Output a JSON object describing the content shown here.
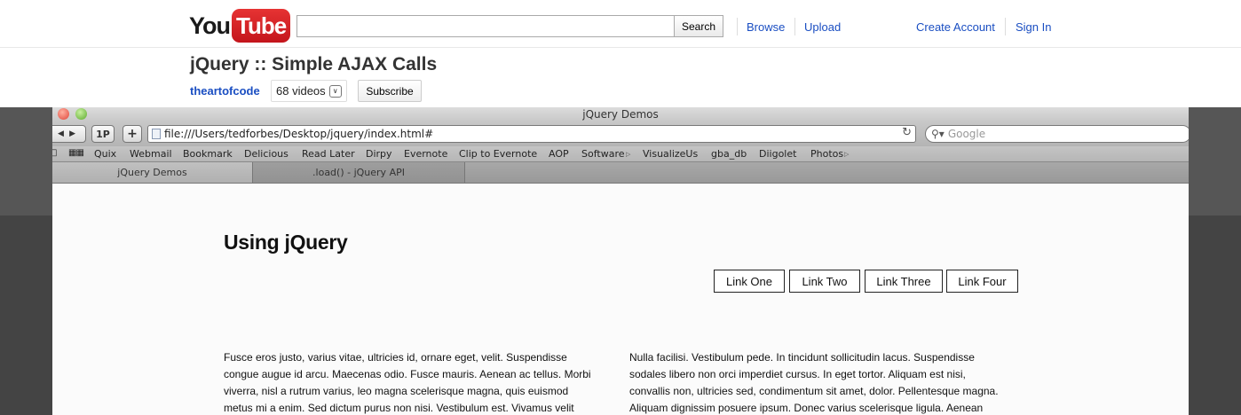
{
  "youtube": {
    "logo_you": "You",
    "logo_tube": "Tube",
    "search_value": "",
    "search_button": "Search",
    "nav": {
      "browse": "Browse",
      "upload": "Upload",
      "create_account": "Create Account",
      "sign_in": "Sign In"
    },
    "video_title": "jQuery :: Simple AJAX Calls",
    "channel": "theartofcode",
    "video_count": "68 videos",
    "subscribe": "Subscribe"
  },
  "browser": {
    "window_title": "jQuery Demos",
    "toolbar": {
      "onepassword": "1P",
      "add_tab": "+",
      "url": "file:///Users/tedforbes/Desktop/jquery/index.html#",
      "search_placeholder": "Google"
    },
    "bookmarks": [
      "Quix",
      "Webmail",
      "Bookmark",
      "Delicious",
      "Read Later",
      "Dirpy",
      "Evernote",
      "Clip to Evernote",
      "AOP",
      "Software",
      "VisualizeUs",
      "gba_db",
      "Diigolet",
      "Photos"
    ],
    "tabs": [
      {
        "label": "jQuery Demos",
        "active": true
      },
      {
        "label": ".load() - jQuery API",
        "active": false
      }
    ]
  },
  "page": {
    "heading": "Using jQuery",
    "links": [
      "Link One",
      "Link Two",
      "Link Three",
      "Link Four"
    ],
    "paragraphs": [
      [
        "Fusce eros justo, varius vitae, ultricies id, ornare eget, velit. Suspendisse",
        "congue augue id arcu. Maecenas odio. Fusce mauris. Aenean ac tellus. Morbi",
        "viverra, nisl a rutrum varius, leo magna scelerisque magna, quis euismod",
        "metus mi a enim. Sed dictum purus non nisi. Vestibulum est. Vivamus velit"
      ],
      [
        "Nulla facilisi. Vestibulum pede. In tincidunt sollicitudin lacus. Suspendisse",
        "sodales libero non orci imperdiet cursus. In eget tortor. Aliquam est nisi,",
        "convallis non, ultricies sed, condimentum sit amet, dolor. Pellentesque magna.",
        "Aliquam dignissim posuere ipsum. Donec varius scelerisque ligula. Aenean"
      ]
    ]
  },
  "colors": {
    "youtube_red": "#d62323",
    "link_blue": "#1a4ec2",
    "video_background": "#444444"
  }
}
